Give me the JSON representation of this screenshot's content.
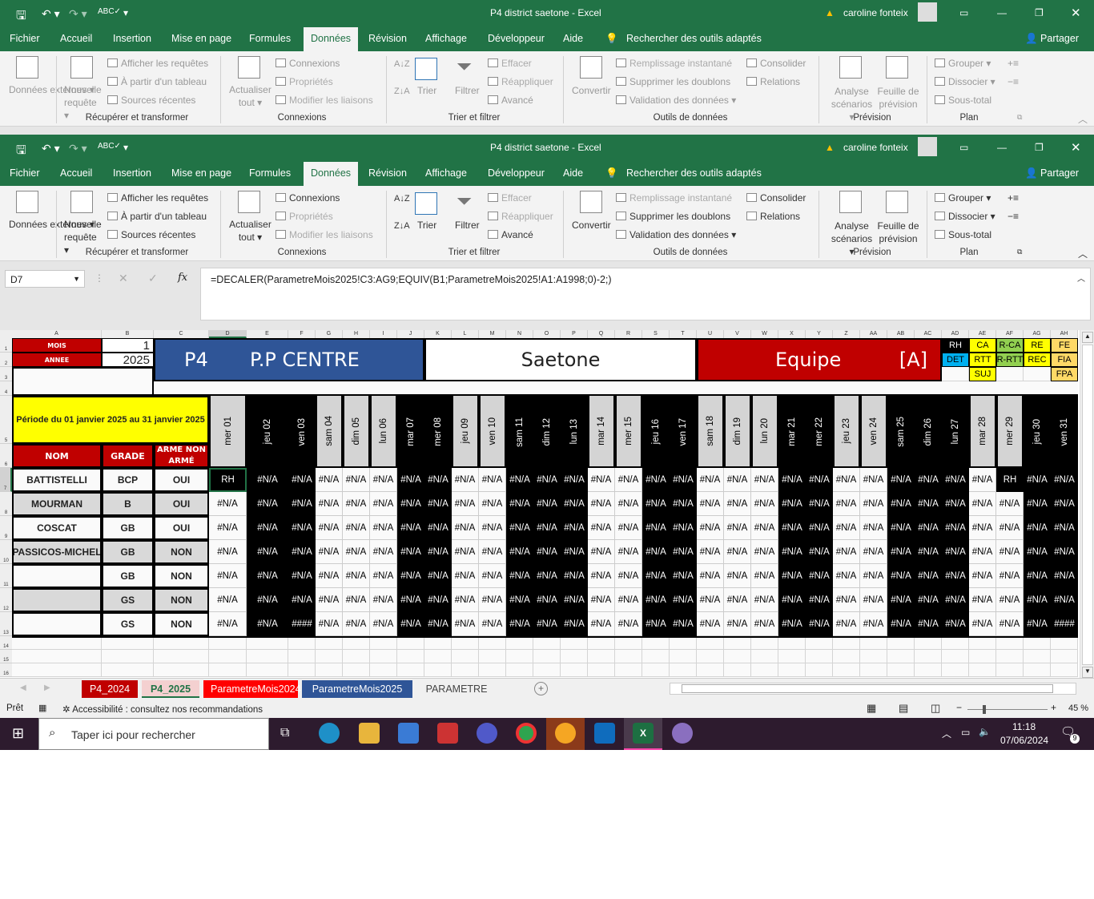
{
  "window": {
    "title": "P4 district saetone  -  Excel",
    "user": "caroline fonteix",
    "share": "Partager"
  },
  "tabs": [
    "Fichier",
    "Accueil",
    "Insertion",
    "Mise en page",
    "Formules",
    "Données",
    "Révision",
    "Affichage",
    "Développeur",
    "Aide"
  ],
  "active_tab": "Données",
  "search_tools": "Rechercher des outils adaptés",
  "ribbon": {
    "donnees_externes": "Données externes",
    "nouvelle_requete": "Nouvelle requête",
    "afficher_requetes": "Afficher les requêtes",
    "partir_tableau": "À partir d'un tableau",
    "sources_recentes": "Sources récentes",
    "actualiser": "Actualiser tout",
    "connexions": "Connexions",
    "proprietes": "Propriétés",
    "modifier_liaisons": "Modifier les liaisons",
    "trier": "Trier",
    "filtrer": "Filtrer",
    "effacer": "Effacer",
    "reappliquer": "Réappliquer",
    "avance": "Avancé",
    "convertir": "Convertir",
    "remplissage": "Remplissage instantané",
    "supprimer_doublons": "Supprimer les doublons",
    "validation": "Validation des données",
    "consolider": "Consolider",
    "relations": "Relations",
    "analyse": "Analyse scénarios",
    "feuille_prevision": "Feuille de prévision",
    "grouper": "Grouper",
    "dissocier": "Dissocier",
    "sous_total": "Sous-total",
    "groups": {
      "recuperer": "Récupérer et transformer",
      "connexions": "Connexions",
      "trier_filtrer": "Trier et filtrer",
      "outils": "Outils de données",
      "prevision": "Prévision",
      "plan": "Plan"
    }
  },
  "formula_bar": {
    "name_box": "D7",
    "formula": "=DECALER(ParametreMois2025!C3:AG9;EQUIV(B1;ParametreMois2025!A1:A1998;0)-2;)"
  },
  "columns": [
    "A",
    "B",
    "C",
    "D",
    "E",
    "F",
    "G",
    "H",
    "I",
    "J",
    "K",
    "L",
    "M",
    "N",
    "O",
    "P",
    "Q",
    "R",
    "S",
    "T",
    "U",
    "V",
    "W",
    "X",
    "Y",
    "Z",
    "AA",
    "AB",
    "AC",
    "AD",
    "AE",
    "AF",
    "AG",
    "AH"
  ],
  "rows": [
    "1",
    "2",
    "3",
    "4",
    "5",
    "6",
    "7",
    "8",
    "9",
    "10",
    "11",
    "12",
    "13",
    "14",
    "15",
    "16"
  ],
  "sheet": {
    "mois_label": "MOIS",
    "mois_value": "1",
    "annee_label": "ANNEE",
    "annee_value": "2025",
    "title_p4": "P4",
    "title_centre": "P.P CENTRE",
    "title_saetone": "Saetone",
    "title_equipe": "Equipe",
    "title_team": "[A]",
    "periode": "Période du 01 janvier 2025 au 31 janvier 2025",
    "hdr_nom": "NOM",
    "hdr_grade": "GRADE",
    "hdr_arme": "ARMÉ NON ARMÉ",
    "legend": [
      {
        "text": "RH",
        "col": 29,
        "row": 0,
        "bg": "#000000",
        "fg": "#ffffff"
      },
      {
        "text": "DET",
        "col": 29,
        "row": 1,
        "bg": "#00b0f0",
        "fg": "#000000"
      },
      {
        "text": "CA",
        "col": 30,
        "row": 0,
        "bg": "#ffff00",
        "fg": "#000000"
      },
      {
        "text": "RTT",
        "col": 30,
        "row": 1,
        "bg": "#ffff00",
        "fg": "#000000"
      },
      {
        "text": "SUJ",
        "col": 30,
        "row": 2,
        "bg": "#ffff00",
        "fg": "#000000"
      },
      {
        "text": "R-CA",
        "col": 31,
        "row": 0,
        "bg": "#92d050",
        "fg": "#000000"
      },
      {
        "text": "R-RTT",
        "col": 31,
        "row": 1,
        "bg": "#92d050",
        "fg": "#000000"
      },
      {
        "text": "RE",
        "col": 32,
        "row": 0,
        "bg": "#ffff00",
        "fg": "#000000"
      },
      {
        "text": "REC",
        "col": 32,
        "row": 1,
        "bg": "#ffff00",
        "fg": "#000000"
      },
      {
        "text": "FE",
        "col": 33,
        "row": 0,
        "bg": "#ffd966",
        "fg": "#000000"
      },
      {
        "text": "FIA",
        "col": 33,
        "row": 1,
        "bg": "#ffd966",
        "fg": "#000000"
      },
      {
        "text": "FPA",
        "col": 33,
        "row": 2,
        "bg": "#ffd966",
        "fg": "#000000"
      }
    ],
    "days": [
      {
        "label": "mer 01",
        "dark": false
      },
      {
        "label": "jeu 02",
        "dark": true
      },
      {
        "label": "ven 03",
        "dark": true
      },
      {
        "label": "sam 04",
        "dark": false
      },
      {
        "label": "dim 05",
        "dark": false
      },
      {
        "label": "lun 06",
        "dark": false
      },
      {
        "label": "mar 07",
        "dark": true
      },
      {
        "label": "mer 08",
        "dark": true
      },
      {
        "label": "jeu 09",
        "dark": false
      },
      {
        "label": "ven 10",
        "dark": false
      },
      {
        "label": "sam 11",
        "dark": true
      },
      {
        "label": "dim 12",
        "dark": true
      },
      {
        "label": "lun 13",
        "dark": true
      },
      {
        "label": "mar 14",
        "dark": false
      },
      {
        "label": "mer 15",
        "dark": false
      },
      {
        "label": "jeu 16",
        "dark": true
      },
      {
        "label": "ven 17",
        "dark": true
      },
      {
        "label": "sam 18",
        "dark": false
      },
      {
        "label": "dim 19",
        "dark": false
      },
      {
        "label": "lun 20",
        "dark": false
      },
      {
        "label": "mar 21",
        "dark": true
      },
      {
        "label": "mer 22",
        "dark": true
      },
      {
        "label": "jeu 23",
        "dark": false
      },
      {
        "label": "ven 24",
        "dark": false
      },
      {
        "label": "sam 25",
        "dark": true
      },
      {
        "label": "dim 26",
        "dark": true
      },
      {
        "label": "lun 27",
        "dark": true
      },
      {
        "label": "mar 28",
        "dark": false
      },
      {
        "label": "mer 29",
        "dark": false
      },
      {
        "label": "jeu 30",
        "dark": true
      },
      {
        "label": "ven 31",
        "dark": true
      }
    ],
    "staff": [
      {
        "nom": "BATTISTELLI",
        "grade": "BCP",
        "arme": "OUI",
        "shade": false,
        "cells": [
          "RH",
          "#N/A",
          "#N/A",
          "#N/A",
          "#N/A",
          "#N/A",
          "#N/A",
          "#N/A",
          "#N/A",
          "#N/A",
          "#N/A",
          "#N/A",
          "#N/A",
          "#N/A",
          "#N/A",
          "#N/A",
          "#N/A",
          "#N/A",
          "#N/A",
          "#N/A",
          "#N/A",
          "#N/A",
          "#N/A",
          "#N/A",
          "#N/A",
          "#N/A",
          "#N/A",
          "#N/A",
          "RH",
          "#N/A",
          "#N/A"
        ]
      },
      {
        "nom": "MOURMAN",
        "grade": "B",
        "arme": "OUI",
        "shade": true,
        "cells": [
          "#N/A",
          "#N/A",
          "#N/A",
          "#N/A",
          "#N/A",
          "#N/A",
          "#N/A",
          "#N/A",
          "#N/A",
          "#N/A",
          "#N/A",
          "#N/A",
          "#N/A",
          "#N/A",
          "#N/A",
          "#N/A",
          "#N/A",
          "#N/A",
          "#N/A",
          "#N/A",
          "#N/A",
          "#N/A",
          "#N/A",
          "#N/A",
          "#N/A",
          "#N/A",
          "#N/A",
          "#N/A",
          "#N/A",
          "#N/A",
          "#N/A"
        ]
      },
      {
        "nom": "COSCAT",
        "grade": "GB",
        "arme": "OUI",
        "shade": false,
        "cells": [
          "#N/A",
          "#N/A",
          "#N/A",
          "#N/A",
          "#N/A",
          "#N/A",
          "#N/A",
          "#N/A",
          "#N/A",
          "#N/A",
          "#N/A",
          "#N/A",
          "#N/A",
          "#N/A",
          "#N/A",
          "#N/A",
          "#N/A",
          "#N/A",
          "#N/A",
          "#N/A",
          "#N/A",
          "#N/A",
          "#N/A",
          "#N/A",
          "#N/A",
          "#N/A",
          "#N/A",
          "#N/A",
          "#N/A",
          "#N/A",
          "#N/A"
        ]
      },
      {
        "nom": "PASSICOS-MICHEL",
        "grade": "GB",
        "arme": "NON",
        "shade": true,
        "cells": [
          "#N/A",
          "#N/A",
          "#N/A",
          "#N/A",
          "#N/A",
          "#N/A",
          "#N/A",
          "#N/A",
          "#N/A",
          "#N/A",
          "#N/A",
          "#N/A",
          "#N/A",
          "#N/A",
          "#N/A",
          "#N/A",
          "#N/A",
          "#N/A",
          "#N/A",
          "#N/A",
          "#N/A",
          "#N/A",
          "#N/A",
          "#N/A",
          "#N/A",
          "#N/A",
          "#N/A",
          "#N/A",
          "#N/A",
          "#N/A",
          "#N/A"
        ]
      },
      {
        "nom": "",
        "grade": "GB",
        "arme": "NON",
        "shade": false,
        "cells": [
          "#N/A",
          "#N/A",
          "#N/A",
          "#N/A",
          "#N/A",
          "#N/A",
          "#N/A",
          "#N/A",
          "#N/A",
          "#N/A",
          "#N/A",
          "#N/A",
          "#N/A",
          "#N/A",
          "#N/A",
          "#N/A",
          "#N/A",
          "#N/A",
          "#N/A",
          "#N/A",
          "#N/A",
          "#N/A",
          "#N/A",
          "#N/A",
          "#N/A",
          "#N/A",
          "#N/A",
          "#N/A",
          "#N/A",
          "#N/A",
          "#N/A"
        ]
      },
      {
        "nom": "",
        "grade": "GS",
        "arme": "NON",
        "shade": true,
        "cells": [
          "#N/A",
          "#N/A",
          "#N/A",
          "#N/A",
          "#N/A",
          "#N/A",
          "#N/A",
          "#N/A",
          "#N/A",
          "#N/A",
          "#N/A",
          "#N/A",
          "#N/A",
          "#N/A",
          "#N/A",
          "#N/A",
          "#N/A",
          "#N/A",
          "#N/A",
          "#N/A",
          "#N/A",
          "#N/A",
          "#N/A",
          "#N/A",
          "#N/A",
          "#N/A",
          "#N/A",
          "#N/A",
          "#N/A",
          "#N/A",
          "#N/A"
        ]
      },
      {
        "nom": "",
        "grade": "GS",
        "arme": "NON",
        "shade": false,
        "cells": [
          "#N/A",
          "#N/A",
          "####",
          "#N/A",
          "#N/A",
          "#N/A",
          "#N/A",
          "#N/A",
          "#N/A",
          "#N/A",
          "#N/A",
          "#N/A",
          "#N/A",
          "#N/A",
          "#N/A",
          "#N/A",
          "#N/A",
          "#N/A",
          "#N/A",
          "#N/A",
          "#N/A",
          "#N/A",
          "#N/A",
          "#N/A",
          "#N/A",
          "#N/A",
          "#N/A",
          "#N/A",
          "#N/A",
          "#N/A",
          "####"
        ]
      }
    ]
  },
  "sheet_tabs": [
    {
      "label": "P4_2024",
      "bg": "#c00000",
      "fg": "#ffffff"
    },
    {
      "label": "P4_2025",
      "bg": "#f4d0d0",
      "fg": "#217346",
      "active": true
    },
    {
      "label": "ParametreMois2024",
      "bg": "#ff0000",
      "fg": "#ffffff"
    },
    {
      "label": "ParametreMois2025",
      "bg": "#2f5597",
      "fg": "#ffffff"
    },
    {
      "label": "PARAMETRE",
      "bg": "#f0f0f0",
      "fg": "#444444"
    }
  ],
  "status": {
    "ready": "Prêt",
    "accessibility": "Accessibilité : consultez nos recommandations",
    "zoom": "45 %"
  },
  "taskbar": {
    "search": "Taper ici pour rechercher",
    "time": "11:18",
    "date": "07/06/2024",
    "notif": "9"
  }
}
